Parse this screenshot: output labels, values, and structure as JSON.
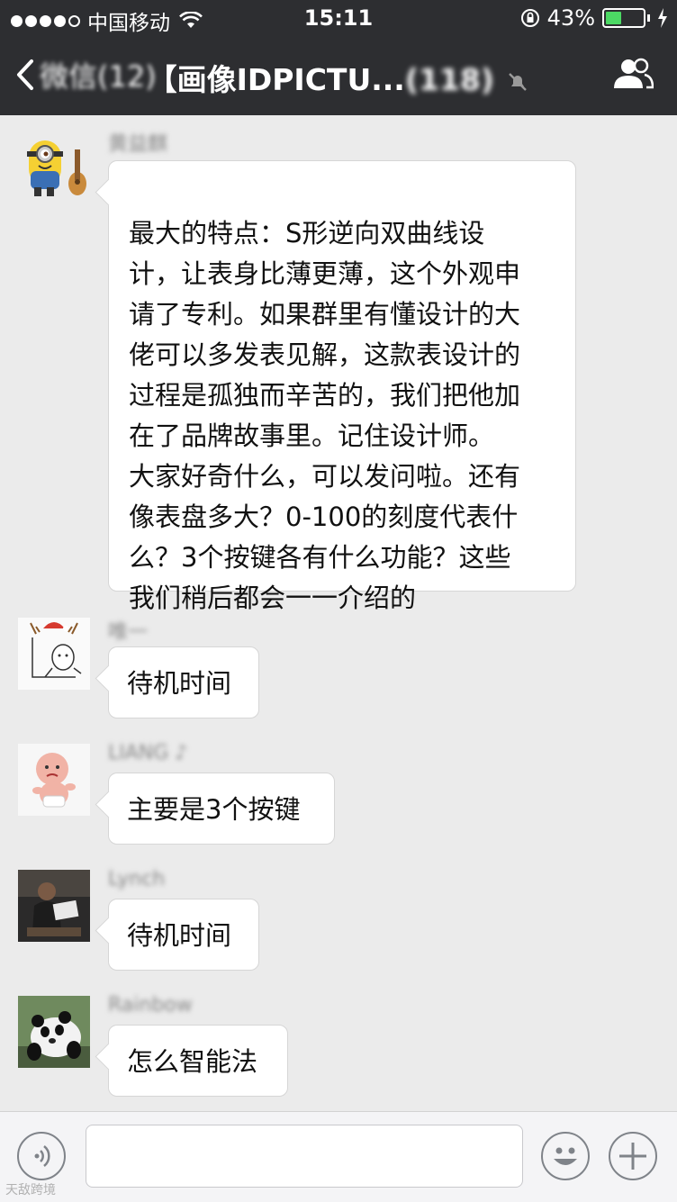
{
  "status_bar": {
    "carrier": "中国移动",
    "time": "15:11",
    "battery_percent": "43%",
    "battery_level": 0.43
  },
  "nav": {
    "back_label": "微信(12)",
    "title": "【画像IDPICTU...",
    "member_count": "(118)"
  },
  "messages": [
    {
      "sender": "黄益麒",
      "avatar": "minion-ukulele-avatar",
      "text": "最大的特点：S形逆向双曲线设计，让表身比薄更薄，这个外观申请了专利。如果群里有懂设计的大佬可以多发表见解，这款表设计的过程是孤独而辛苦的，我们把他加在了品牌故事里。记住设计师。大家好奇什么，可以发问啦。还有像表盘多大？0-100的刻度代表什么？3个按键各有什么功能？这些我们稍后都会一一介绍的",
      "lines": [
        "最大的特点：S形逆向双曲线设",
        "计，让表身比薄更薄，这个外观申",
        "请了专利。如果群里有懂设计的大",
        "佬可以多发表见解，这款表设计的",
        "过程是孤独而辛苦的，我们把他加",
        "在了品牌故事里。记住设计师。",
        "大家好奇什么，可以发问啦。还有",
        "像表盘多大？0-100的刻度代表什",
        "么？3个按键各有什么功能？这些",
        "我们稍后都会一一介绍的"
      ]
    },
    {
      "sender": "唯一",
      "avatar": "christmas-doodle-avatar",
      "text": "待机时间"
    },
    {
      "sender": "LIANG ♪",
      "avatar": "baby-cartoon-avatar",
      "text": "主要是3个按键"
    },
    {
      "sender": "Lynch",
      "avatar": "photo-man-avatar",
      "text": "待机时间"
    },
    {
      "sender": "Rainbow",
      "avatar": "panda-photo-avatar",
      "text": "怎么智能法"
    }
  ],
  "input_bar": {
    "voice_icon": "voice-icon",
    "emoji_icon": "emoji-icon",
    "plus_icon": "plus-icon",
    "draft": ""
  },
  "watermark": "天敌跨境"
}
